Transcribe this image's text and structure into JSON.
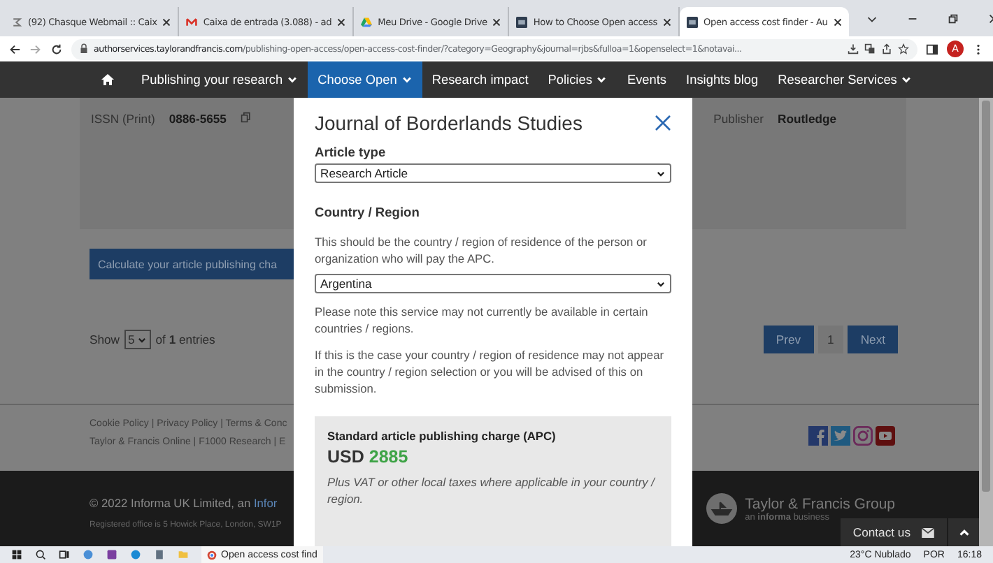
{
  "browser": {
    "tabs": [
      {
        "title": "(92) Chasque Webmail :: Caix",
        "kind": "webmail",
        "selected": false
      },
      {
        "title": "Caixa de entrada (3.088) - ad",
        "kind": "mail",
        "selected": false
      },
      {
        "title": "Meu Drive - Google Drive",
        "kind": "drive",
        "selected": false
      },
      {
        "title": "How to Choose Open access",
        "kind": "site",
        "selected": false
      },
      {
        "title": "Open access cost finder - Au",
        "kind": "site",
        "selected": true
      }
    ],
    "url_host": "authorservices.taylorandfrancis.com",
    "url_path": "/publishing-open-access/open-access-cost-finder/?category=Geography&journal=rjbs&fulloa=1&openselect=1&notavai...",
    "profile": "A"
  },
  "nav": {
    "items": [
      {
        "label": "Publishing your research",
        "dropdown": true,
        "selected": false
      },
      {
        "label": "Choose Open",
        "dropdown": true,
        "selected": true
      },
      {
        "label": "Research impact",
        "dropdown": false,
        "selected": false
      },
      {
        "label": "Policies",
        "dropdown": true,
        "selected": false
      },
      {
        "label": "Events",
        "dropdown": false,
        "selected": false
      },
      {
        "label": "Insights blog",
        "dropdown": false,
        "selected": false
      },
      {
        "label": "Researcher Services",
        "dropdown": true,
        "selected": false
      }
    ]
  },
  "journal_card": {
    "issn_label": "ISSN (Print)",
    "issn": "0886-5655",
    "publisher_label": "Publisher",
    "publisher": "Routledge"
  },
  "calculate_button": "Calculate your article publishing cha",
  "entries": {
    "show": "Show",
    "count": "5",
    "of": "of",
    "total": "1",
    "suffix": "entries"
  },
  "pagination": {
    "prev": "Prev",
    "page": "1",
    "next": "Next"
  },
  "footer": {
    "links_1": "Cookie Policy | Privacy Policy | Terms & Conc",
    "links_2": "Taylor & Francis Online | F1000 Research | E",
    "copyright": "© 2022 Informa UK Limited, an ",
    "copyright_link": "Infor",
    "registered": "Registered office is 5 Howick Place, London, SW1P",
    "brand": "Taylor & Francis Group",
    "brand_sub_pre": "an ",
    "brand_sub_bold": "informa",
    "brand_sub_post": " business",
    "contact": "Contact us"
  },
  "modal": {
    "title": "Journal of Borderlands Studies",
    "article_type_label": "Article type",
    "article_type": "Research Article",
    "country_label": "Country / Region",
    "country_help": "This should be the country / region of residence of the person or organization who will pay the APC.",
    "country": "Argentina",
    "notes": [
      "Please note this service may not currently be available in certain countries / regions.",
      "If this is the case your country / region of residence may not appear in the country / region selection or you will be advised of this on submission."
    ],
    "apc_label": "Standard article publishing charge (APC)",
    "currency": "USD",
    "amount": "2885",
    "apc_note": "Plus VAT or other local taxes where applicable in your country / region."
  },
  "taskbar": {
    "app": "Open access cost find",
    "weather": "23°C  Nublado",
    "lang": "POR",
    "time": "16:18"
  }
}
